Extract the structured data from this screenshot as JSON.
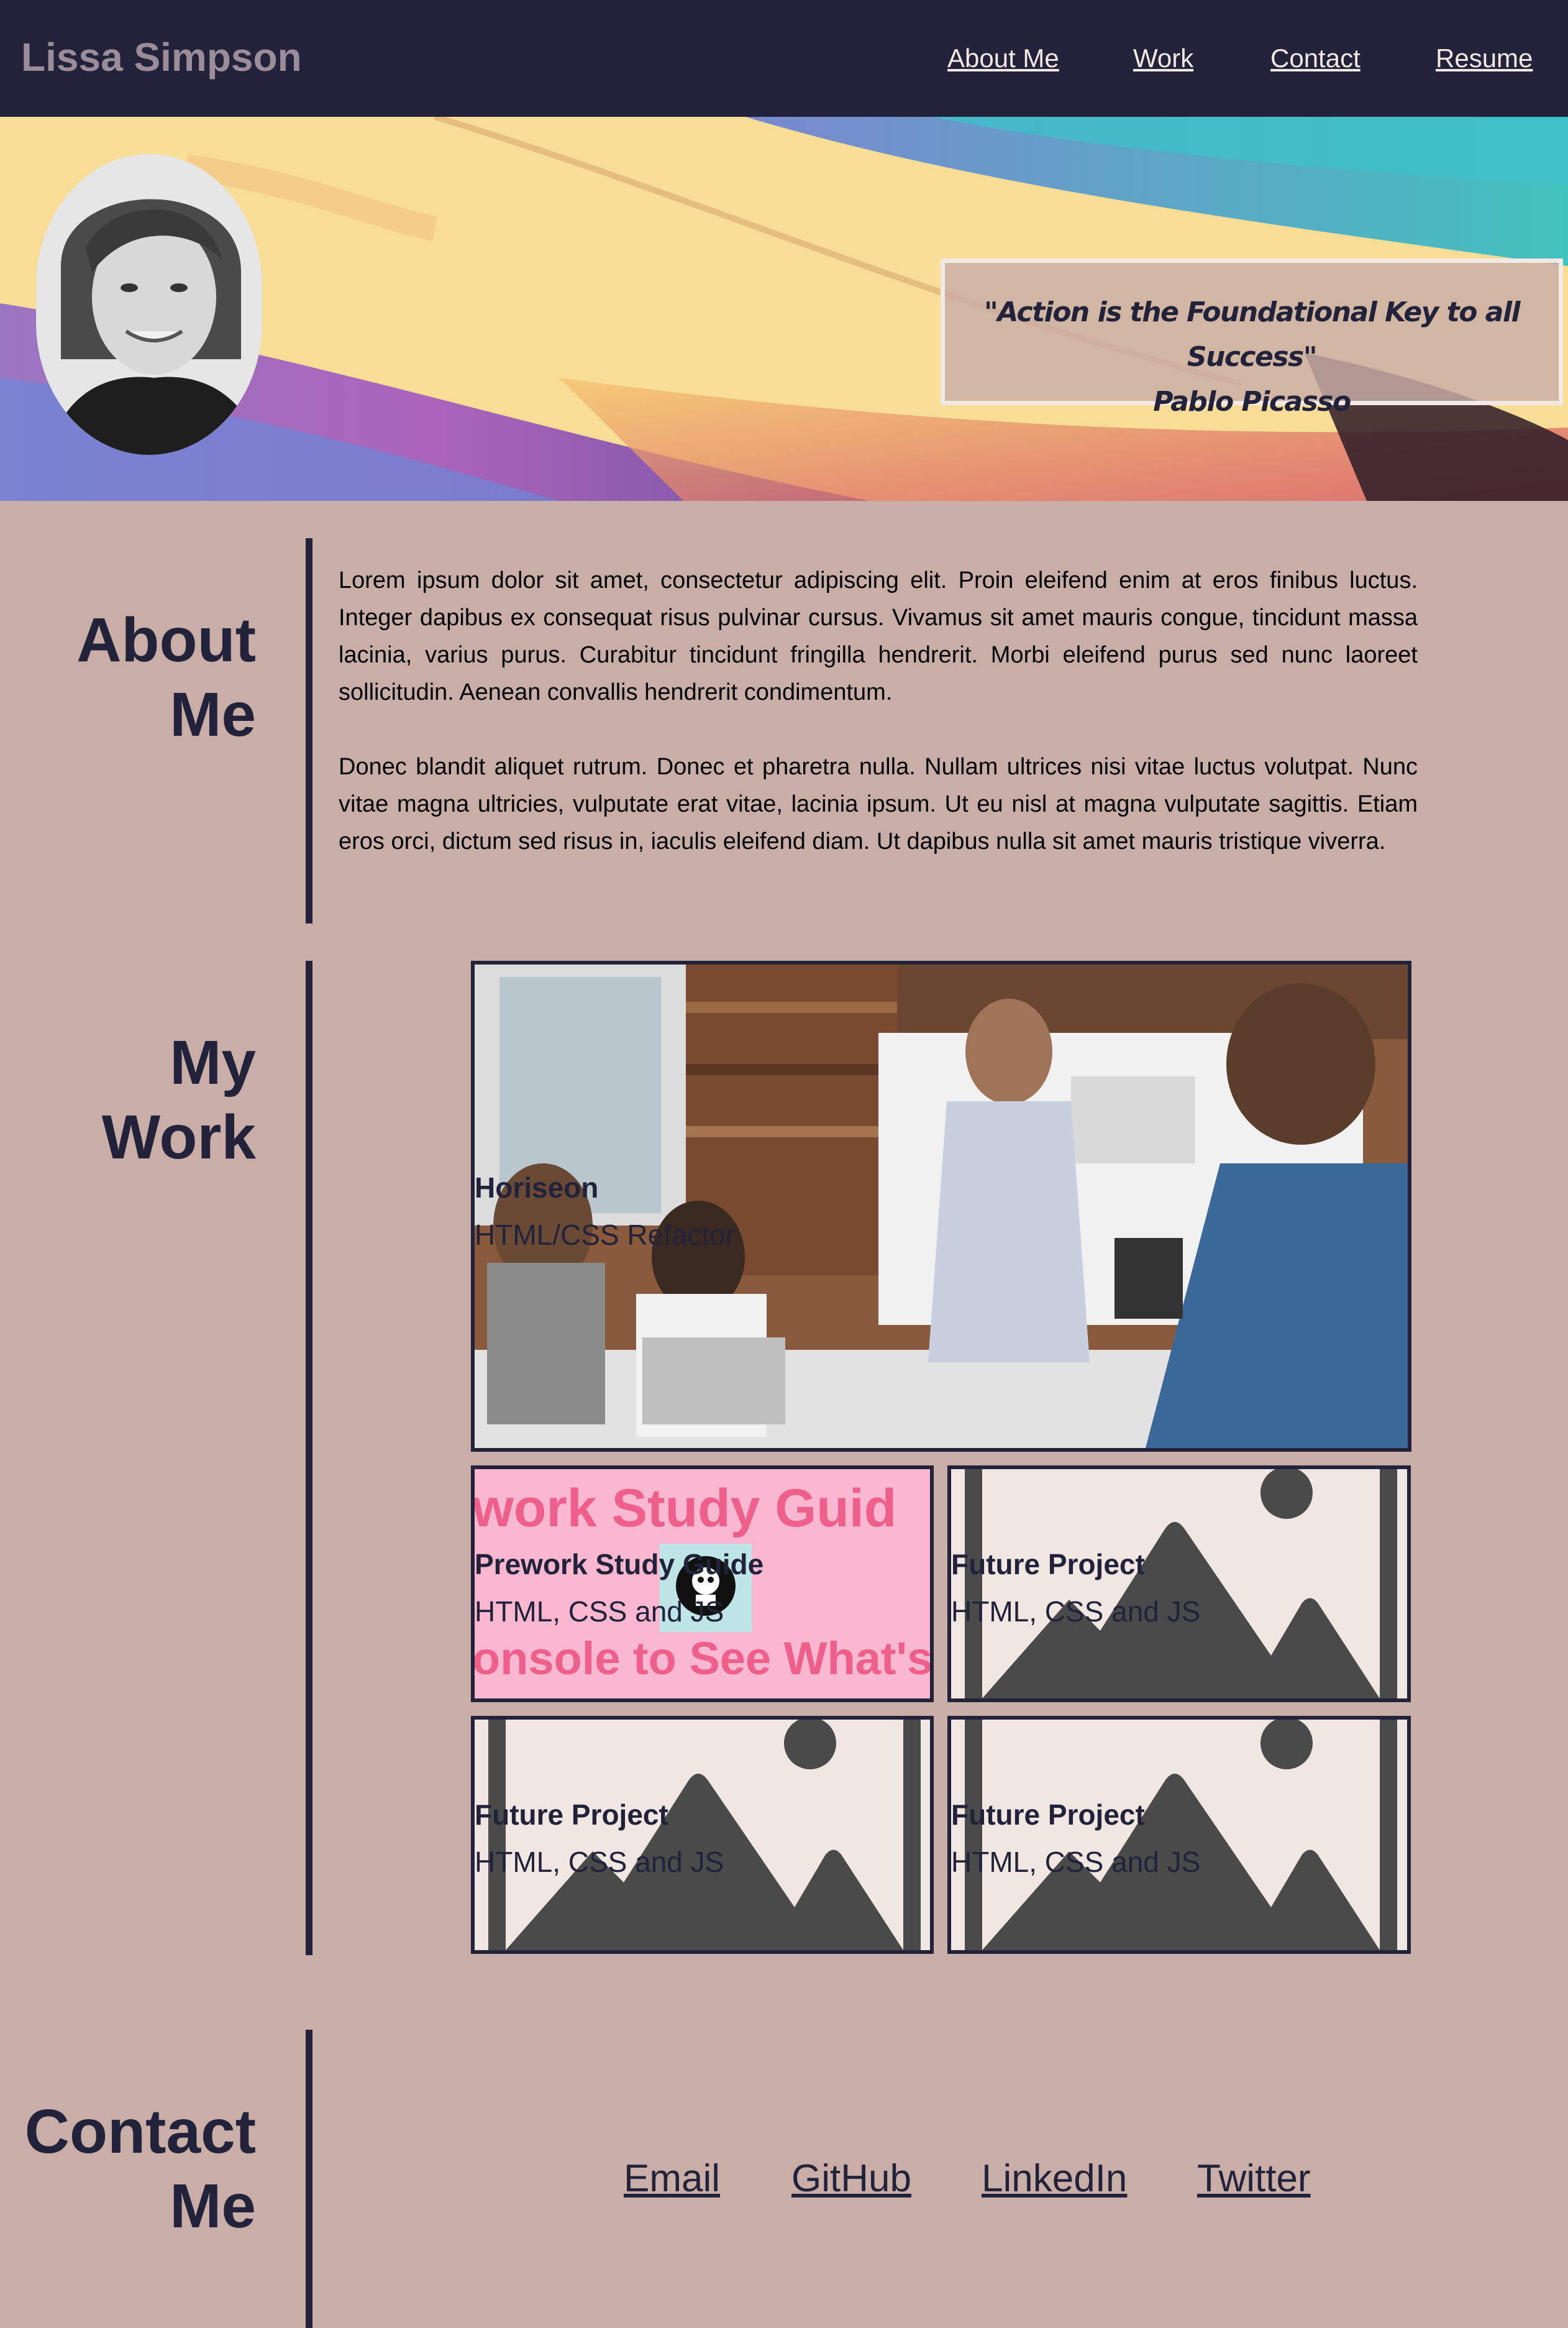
{
  "header": {
    "brand": "Lissa Simpson",
    "nav": [
      "About Me",
      "Work",
      "Contact",
      "Resume"
    ]
  },
  "hero": {
    "quote": "\"Action is the Foundational Key to all Success\"",
    "author": "Pablo Picasso"
  },
  "about": {
    "heading_line1": "About",
    "heading_line2": "Me",
    "paragraphs": [
      "Lorem ipsum dolor sit amet, consectetur adipiscing elit. Proin eleifend enim at eros finibus luctus. Integer dapibus ex consequat risus pulvinar cursus. Vivamus sit amet mauris congue, tincidunt massa lacinia, varius purus. Curabitur tincidunt fringilla hendrerit. Morbi eleifend purus sed nunc laoreet sollicitudin. Aenean convallis hendrerit condimentum.",
      "Donec blandit aliquet rutrum. Donec et pharetra nulla. Nullam ultrices nisi vitae luctus volutpat. Nunc vitae magna ultricies, vulputate erat vitae, lacinia ipsum. Ut eu nisl at magna vulputate sagittis. Etiam eros orci, dictum sed risus in, iaculis eleifend diam. Ut dapibus nulla sit amet mauris tristique viverra."
    ]
  },
  "work": {
    "heading": "My Work",
    "projects": [
      {
        "title": "Horiseon",
        "subtitle": "HTML/CSS Refactor"
      },
      {
        "title": "Prework Study Guide",
        "subtitle": "HTML, CSS and JS",
        "banner_top": "work Study Guid",
        "banner_bottom": "onsole to See What's I"
      },
      {
        "title": "Future Project",
        "subtitle": "HTML, CSS and JS"
      },
      {
        "title": "Future Project",
        "subtitle": "HTML, CSS and JS"
      },
      {
        "title": "Future Project",
        "subtitle": "HTML, CSS and JS"
      }
    ]
  },
  "contact": {
    "heading_line1": "Contact",
    "heading_line2": "Me",
    "links": [
      "Email",
      "GitHub",
      "LinkedIn",
      "Twitter"
    ]
  },
  "colors": {
    "navy": "#22223b",
    "mauve": "#9a8c98",
    "rose": "#c9ada7",
    "cream": "#f2e9e4",
    "placeholder_gray": "#4a4a4a"
  },
  "icons": [
    "mountain-placeholder-icon",
    "github-octocat-icon"
  ]
}
